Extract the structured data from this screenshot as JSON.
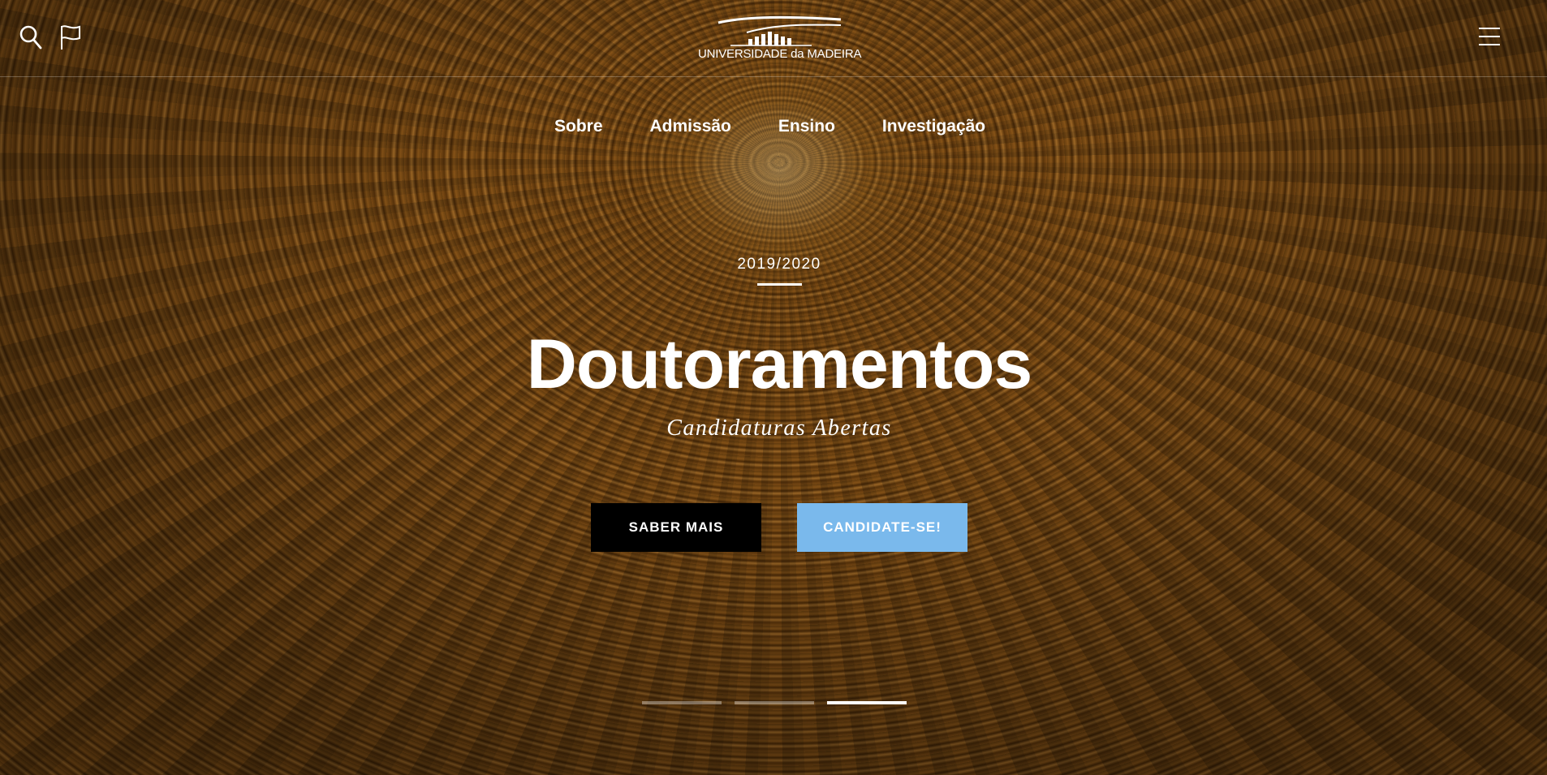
{
  "header": {
    "logo_text": "UNIVERSIDADE da MADEIRA",
    "icons": [
      "search-icon",
      "flag-icon",
      "hamburger-menu-icon"
    ]
  },
  "nav": {
    "items": [
      {
        "label": "Sobre"
      },
      {
        "label": "Admissão"
      },
      {
        "label": "Ensino"
      },
      {
        "label": "Investigação"
      }
    ]
  },
  "hero": {
    "year": "2019/2020",
    "title": "Doutoramentos",
    "subtitle": "Candidaturas Abertas",
    "buttons": {
      "more_label": "SABER MAIS",
      "apply_label": "CANDIDATE-SE!"
    },
    "slides": {
      "count": 3,
      "active_index": 3
    }
  },
  "colors": {
    "apply_button": "#7ab9ec",
    "more_button": "#000000",
    "text": "#ffffff"
  }
}
